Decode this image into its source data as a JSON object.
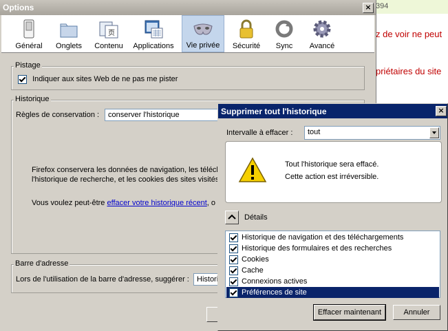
{
  "background": {
    "counter": "394",
    "line1": "z de voir ne peut",
    "line2": "priétaires du site"
  },
  "options": {
    "title": "Options",
    "toolbar": [
      {
        "label": "Général",
        "icon": "switch-icon"
      },
      {
        "label": "Onglets",
        "icon": "tabs-icon"
      },
      {
        "label": "Contenu",
        "icon": "content-icon"
      },
      {
        "label": "Applications",
        "icon": "applications-icon"
      },
      {
        "label": "Vie privée",
        "icon": "mask-icon"
      },
      {
        "label": "Sécurité",
        "icon": "padlock-icon"
      },
      {
        "label": "Sync",
        "icon": "sync-icon"
      },
      {
        "label": "Avancé",
        "icon": "gear-icon"
      }
    ],
    "tracking": {
      "legend": "Pistage",
      "checkbox_label": "Indiquer aux sites Web de ne pas me pister"
    },
    "history": {
      "legend": "Historique",
      "rules_label": "Règles de conservation :",
      "rules_value": "conserver l'historique",
      "desc_line1": "Firefox conservera les données de navigation, les téléch",
      "desc_line2": "l'historique de recherche, et les cookies des sites visités.",
      "recent_prefix": "Vous voulez peut-être ",
      "recent_link": "effacer votre historique récent",
      "recent_suffix": ", o"
    },
    "address_bar": {
      "legend": "Barre d'adresse",
      "label": "Lors de l'utilisation de la barre d'adresse, suggérer :",
      "value": "Histori"
    }
  },
  "dialog": {
    "title": "Supprimer tout l'historique",
    "range_label": "Intervalle à effacer :",
    "range_value": "tout",
    "warning_line1": "Tout l'historique sera effacé.",
    "warning_line2": "Cette action est irréversible.",
    "details_label": "Détails",
    "items": [
      {
        "label": "Historique de navigation et des téléchargements",
        "checked": true
      },
      {
        "label": "Historique des formulaires et des recherches",
        "checked": true
      },
      {
        "label": "Cookies",
        "checked": true
      },
      {
        "label": "Cache",
        "checked": true
      },
      {
        "label": "Connexions actives",
        "checked": true
      },
      {
        "label": "Préférences de site",
        "checked": true
      }
    ],
    "clear_button": "Effacer maintenant",
    "cancel_button": "Annuler"
  }
}
